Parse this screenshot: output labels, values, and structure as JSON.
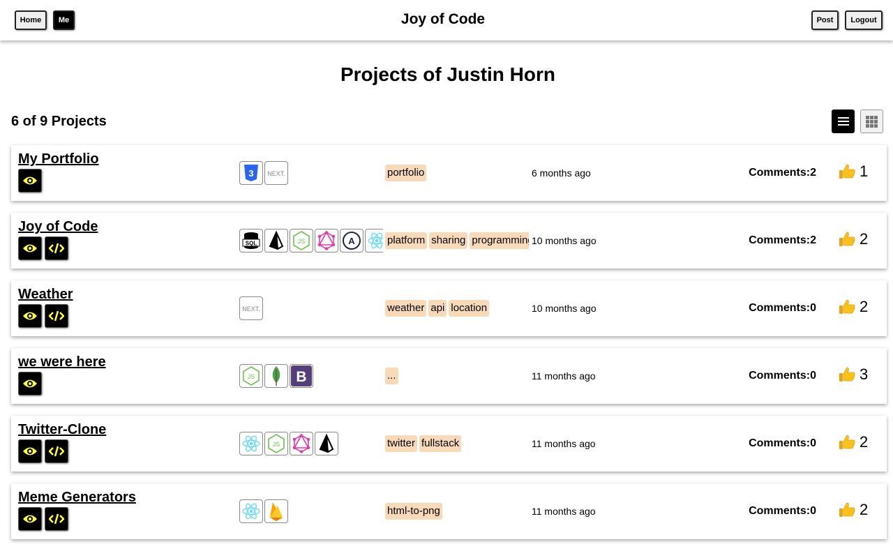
{
  "header": {
    "title": "Joy of Code",
    "home_label": "Home",
    "me_label": "Me",
    "post_label": "Post",
    "logout_label": "Logout"
  },
  "page": {
    "title": "Projects of Justin Horn",
    "count_label": "6 of 9 Projects"
  },
  "colors": {
    "tag_bg": "#f8d9b8",
    "action_icon": "#ffff33"
  },
  "projects": [
    {
      "title": "My Portfolio",
      "actions": [
        "eye-icon"
      ],
      "techs": [
        "css3-icon",
        "nextjs-icon"
      ],
      "tags": [
        "portfolio"
      ],
      "date": "6 months ago",
      "comments": "Comments:2",
      "likes": "1"
    },
    {
      "title": "Joy of Code",
      "actions": [
        "eye-icon",
        "code-icon"
      ],
      "techs": [
        "sql-icon",
        "prisma-icon",
        "nodejs-icon",
        "graphql-icon",
        "apollo-icon",
        "react-icon"
      ],
      "tags": [
        "platform",
        "sharing",
        "programming"
      ],
      "date": "10 months ago",
      "comments": "Comments:2",
      "likes": "2"
    },
    {
      "title": "Weather",
      "actions": [
        "eye-icon",
        "code-icon"
      ],
      "techs": [
        "nextjs-icon"
      ],
      "tags": [
        "weather",
        "api",
        "location"
      ],
      "date": "10 months ago",
      "comments": "Comments:0",
      "likes": "2"
    },
    {
      "title": "we were here",
      "actions": [
        "eye-icon"
      ],
      "techs": [
        "nodejs-icon",
        "mongodb-icon",
        "bootstrap-icon"
      ],
      "tags": [
        "..."
      ],
      "date": "11 months ago",
      "comments": "Comments:0",
      "likes": "3"
    },
    {
      "title": "Twitter-Clone",
      "actions": [
        "eye-icon",
        "code-icon"
      ],
      "techs": [
        "react-icon",
        "nodejs-icon",
        "graphql-icon",
        "prisma-icon"
      ],
      "tags": [
        "twitter",
        "fullstack"
      ],
      "date": "11 months ago",
      "comments": "Comments:0",
      "likes": "2"
    },
    {
      "title": "Meme Generators",
      "actions": [
        "eye-icon",
        "code-icon"
      ],
      "techs": [
        "react-icon",
        "firebase-icon"
      ],
      "tags": [
        "html-to-png"
      ],
      "date": "11 months ago",
      "comments": "Comments:0",
      "likes": "2"
    }
  ]
}
